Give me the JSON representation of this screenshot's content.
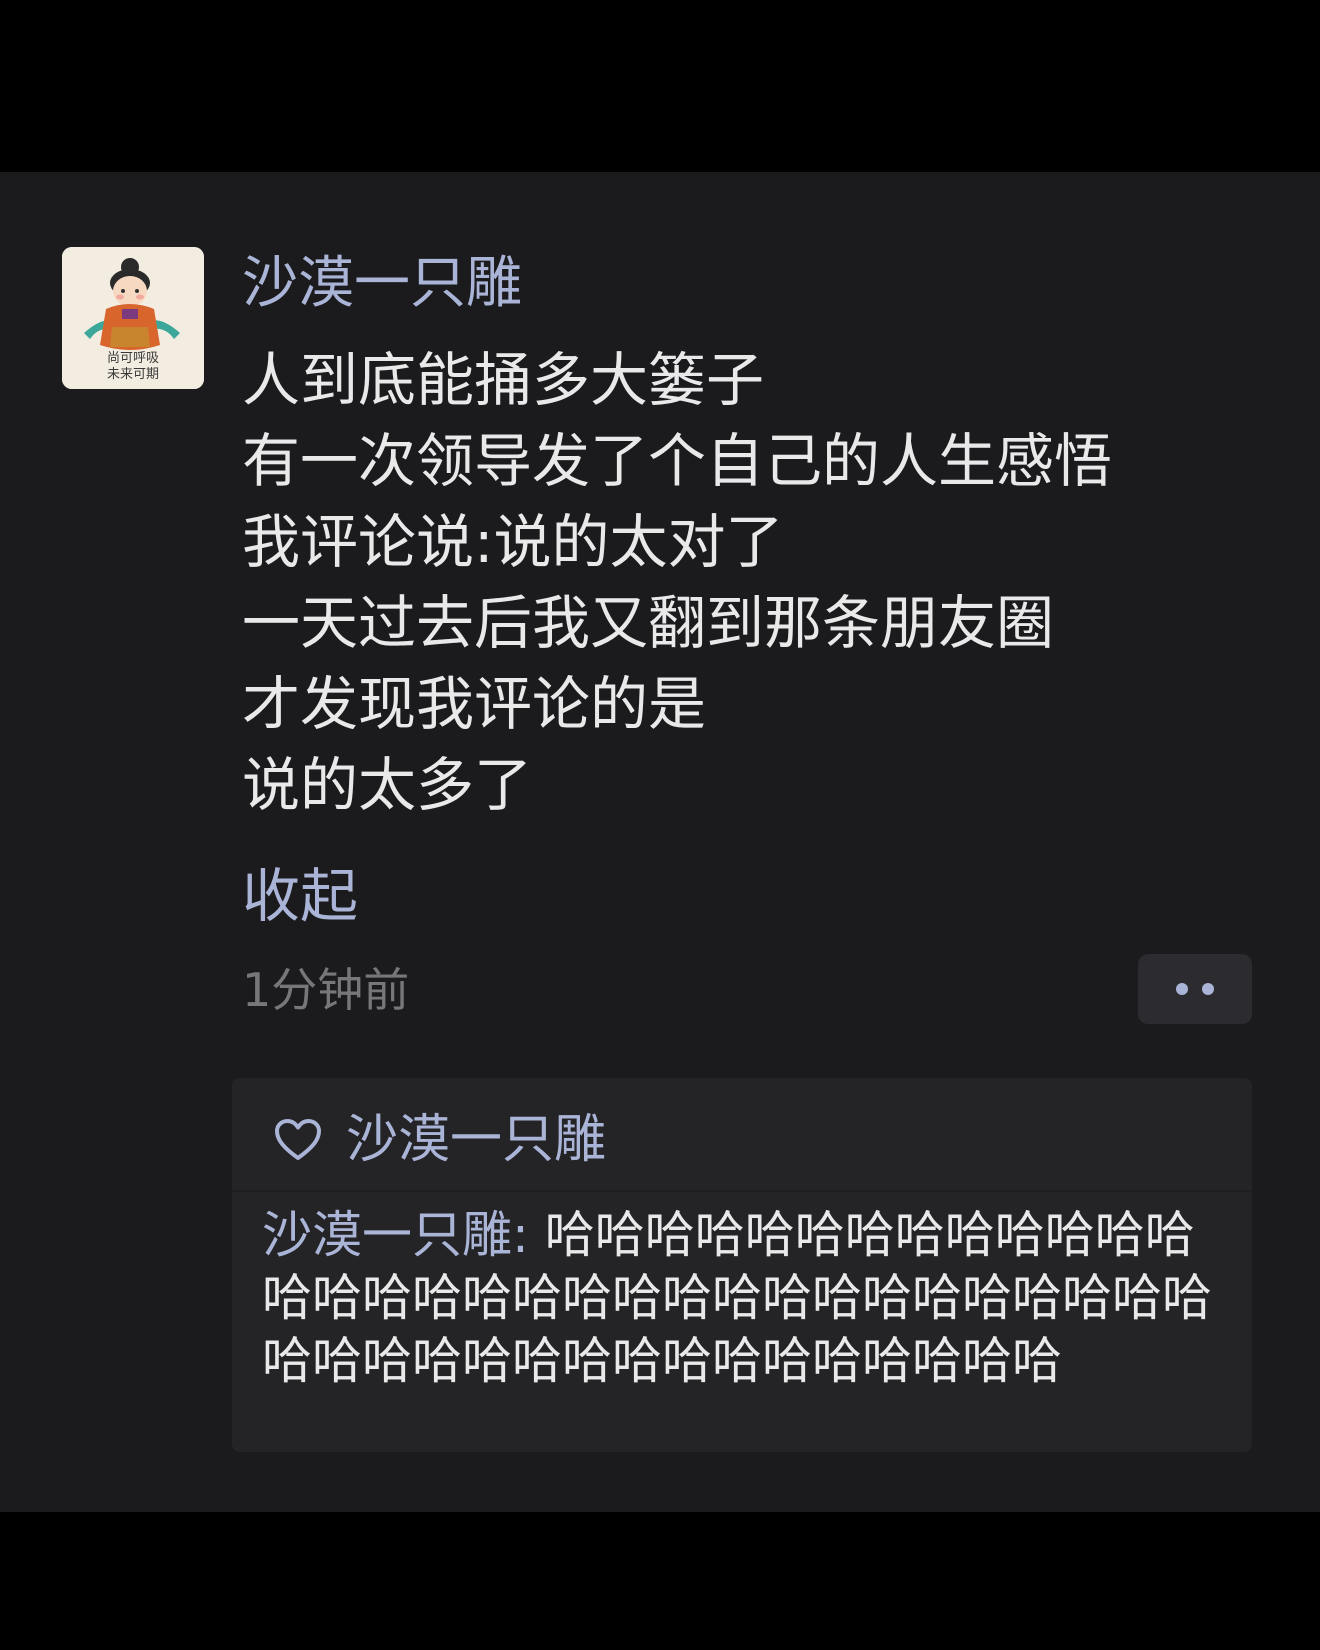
{
  "post": {
    "username": "沙漠一只雕",
    "avatar_caption_line1": "尚可呼吸",
    "avatar_caption_line2": "未来可期",
    "lines": [
      "人到底能捅多大篓子",
      "有一次领导发了个自己的人生感悟",
      "我评论说:说的太对了",
      "一天过去后我又翻到那条朋友圈",
      "才发现我评论的是",
      "说的太多了"
    ],
    "collapse_label": "收起",
    "timestamp": "1分钟前"
  },
  "likes": {
    "icon": "heart-icon",
    "names": "沙漠一只雕"
  },
  "comment": {
    "author": "沙漠一只雕",
    "separator": ": ",
    "text": "哈哈哈哈哈哈哈哈哈哈哈哈哈哈哈哈哈哈哈哈哈哈哈哈哈哈哈哈哈哈哈哈哈哈哈哈哈哈哈哈哈哈哈哈哈哈哈哈"
  },
  "colors": {
    "background": "#1b1b1d",
    "name_accent": "#aab4d6",
    "text": "#e9e9ea",
    "muted": "#77777b"
  }
}
